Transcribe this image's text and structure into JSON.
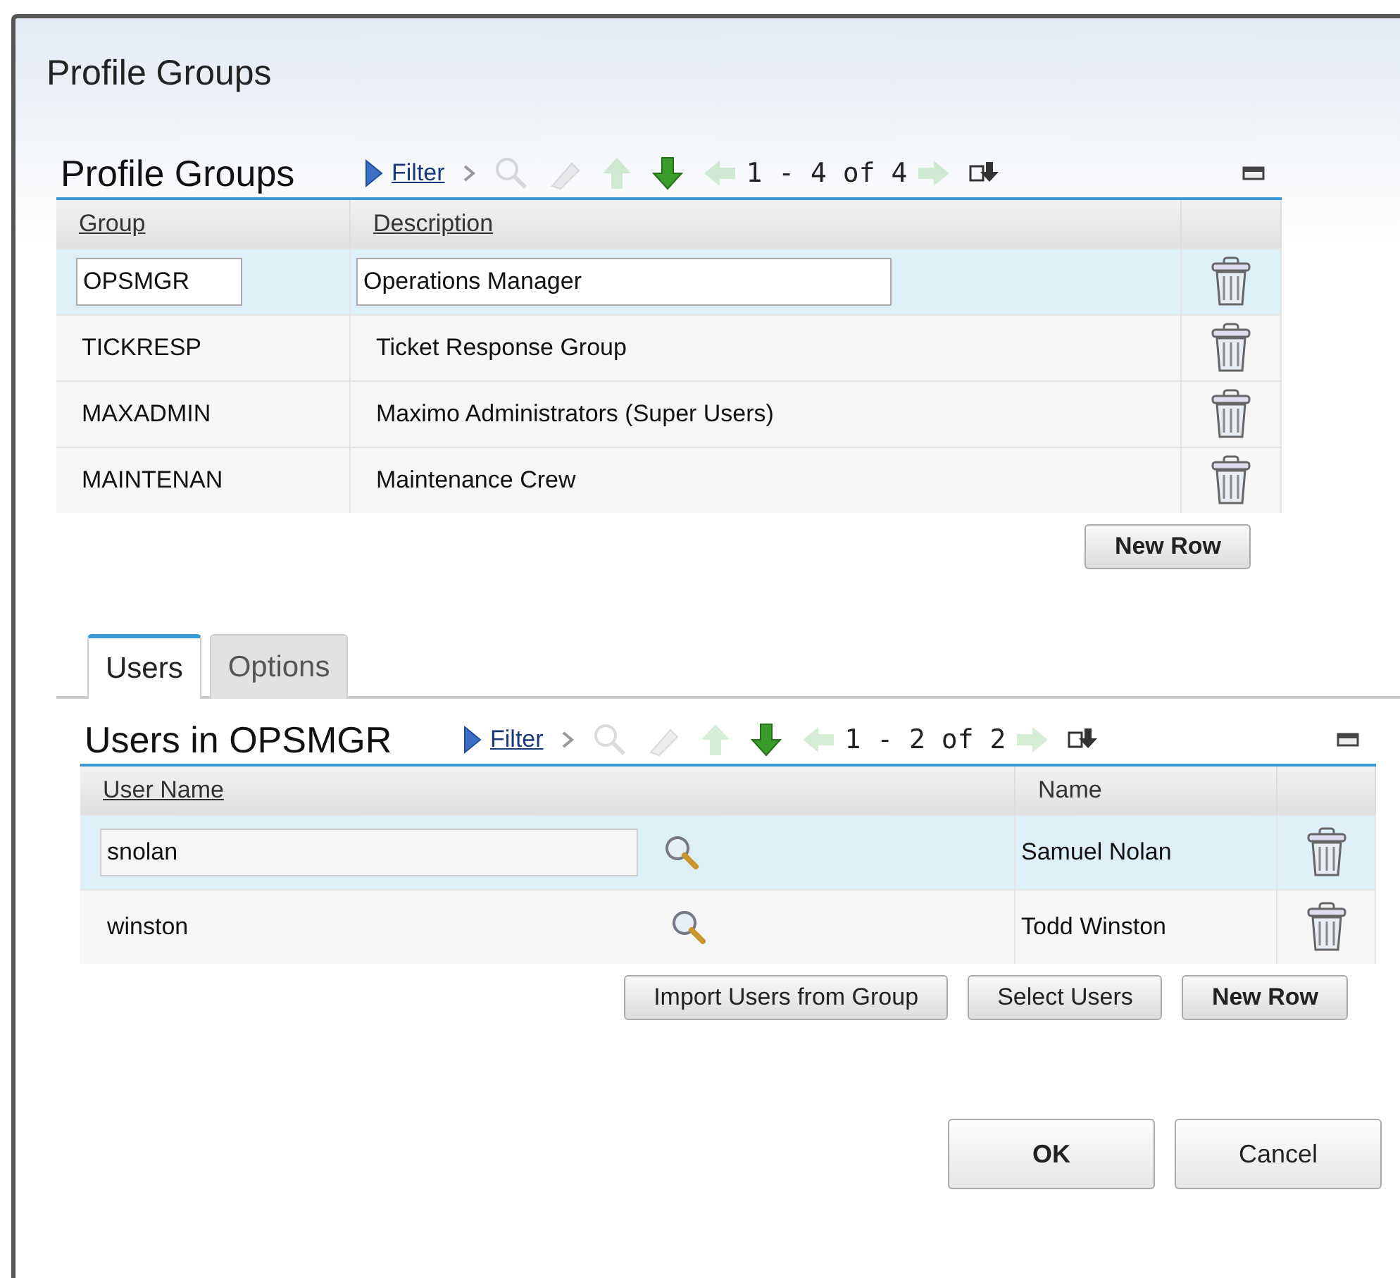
{
  "window": {
    "title": "Profile Groups"
  },
  "groups_table": {
    "title": "Profile Groups",
    "filter": "Filter",
    "pagination": "1 - 4 of 4",
    "columns": [
      "Group",
      "Description"
    ],
    "rows": [
      {
        "group": "OPSMGR",
        "description": "Operations Manager",
        "selected": true
      },
      {
        "group": "TICKRESP",
        "description": "Ticket Response Group",
        "selected": false
      },
      {
        "group": "MAXADMIN",
        "description": "Maximo Administrators (Super Users)",
        "selected": false
      },
      {
        "group": "MAINTENAN",
        "description": "Maintenance Crew",
        "selected": false
      }
    ],
    "buttons": [
      {
        "label": "New Row",
        "default": true
      }
    ]
  },
  "tabs": [
    {
      "label": "Users",
      "selected": true
    },
    {
      "label": "Options",
      "selected": false
    }
  ],
  "users_table": {
    "title": "Users in OPSMGR",
    "filter": "Filter",
    "pagination": "1 - 2 of 2",
    "columns": [
      "User Name",
      "Name"
    ],
    "rows": [
      {
        "user_name": "snolan",
        "name": "Samuel Nolan",
        "selected": true
      },
      {
        "user_name": "winston",
        "name": "Todd Winston",
        "selected": false
      }
    ],
    "buttons": [
      {
        "label": "Import Users from Group",
        "default": false
      },
      {
        "label": "Select Users",
        "default": false
      },
      {
        "label": "New Row",
        "default": true
      }
    ]
  },
  "footer_buttons": [
    {
      "label": "OK",
      "default": true
    },
    {
      "label": "Cancel",
      "default": false
    }
  ]
}
